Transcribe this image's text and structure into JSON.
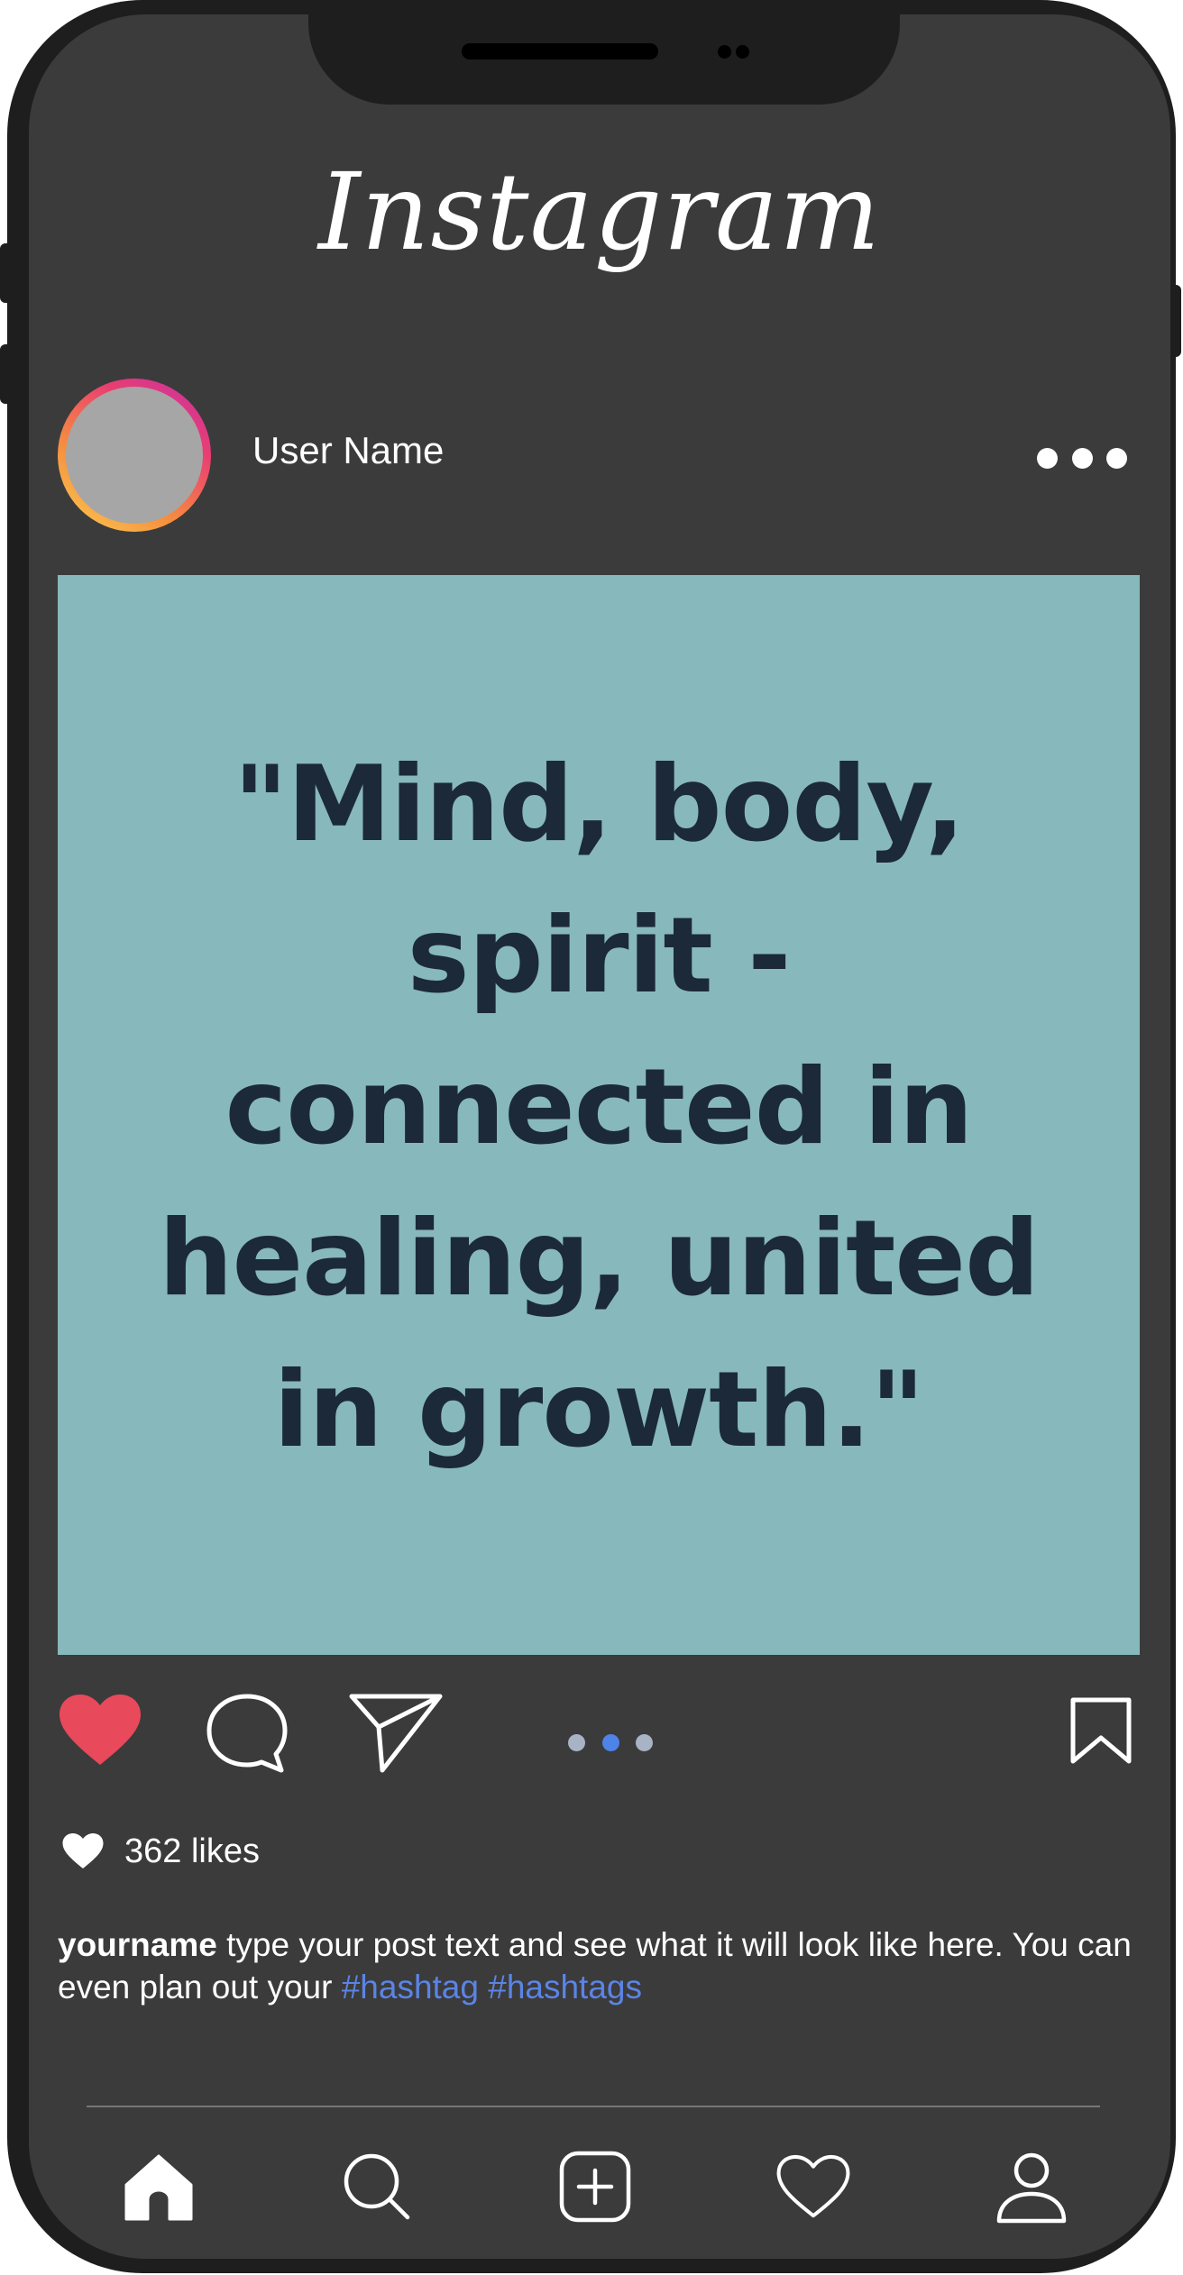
{
  "app": {
    "logo_text": "Instagram"
  },
  "post": {
    "username": "User Name",
    "quote_text": "\"Mind, body,\nspirit -\nconnected in\nhealing, united\nin growth.\"",
    "image_background": "#87b8bc",
    "carousel": {
      "pages": 3,
      "active_index": 1
    },
    "likes_text": "362 likes",
    "caption": {
      "author": "yourname",
      "text": " type your post text and see what it will look like here. You can even plan out your ",
      "hashtags": [
        "#hashtag",
        "#hashtags"
      ]
    }
  },
  "actions": {
    "like_icon": "heart-filled-icon",
    "comment_icon": "speech-bubble-icon",
    "share_icon": "paper-plane-icon",
    "save_icon": "bookmark-icon",
    "like_color": "#e8495b"
  },
  "bottom_nav": {
    "items": [
      "home-icon",
      "search-icon",
      "add-post-icon",
      "activity-heart-icon",
      "profile-icon"
    ]
  },
  "colors": {
    "screen_bg": "#3b3b3b",
    "text": "#ffffff",
    "hashtag": "#5b84e6",
    "quote": "#1c2939"
  }
}
